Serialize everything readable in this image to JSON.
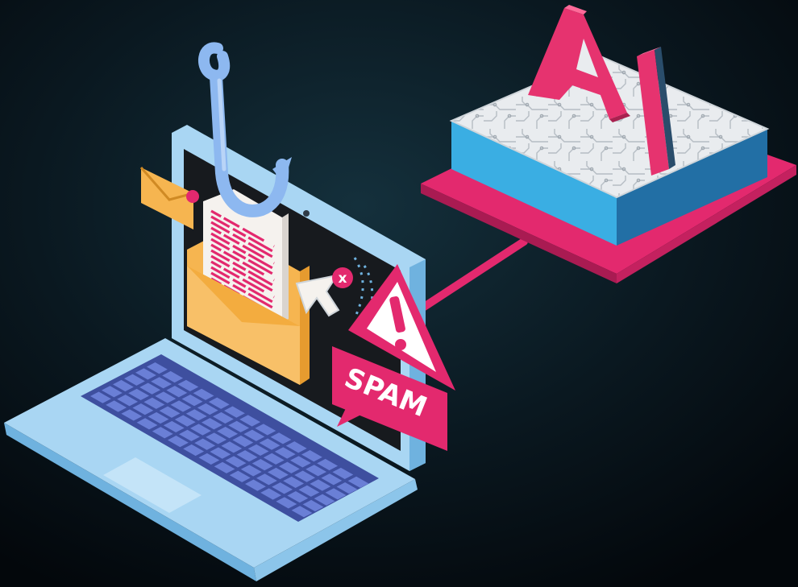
{
  "scene": {
    "spam_label": "SPAM",
    "ai_label": "AI",
    "close_glyph": "x",
    "colors": {
      "background_center": "#132a36",
      "background_edge": "#04090e",
      "laptop_body": "#a9d6f3",
      "laptop_body_shade": "#7fbfe6",
      "laptop_edge": "#5ea8d8",
      "screen": "#171a1e",
      "keyboard": "#4b5db5",
      "key": "#6a7fd6",
      "envelope": "#f6b550",
      "envelope_shade": "#e69b2f",
      "letter_lines": "#e3296e",
      "accent_pink": "#e3296e",
      "hook": "#8db8f0",
      "chip_top": "#eef0f2",
      "chip_side_light": "#42b0e2",
      "chip_side_dark": "#2a88c0",
      "ai_letters": "#e6336f"
    },
    "icons": [
      "fishing-hook-icon",
      "email-envelope-icon",
      "notification-dot-icon",
      "pointer-cursor-icon",
      "close-icon",
      "warning-triangle-icon",
      "ai-chip-icon"
    ]
  }
}
